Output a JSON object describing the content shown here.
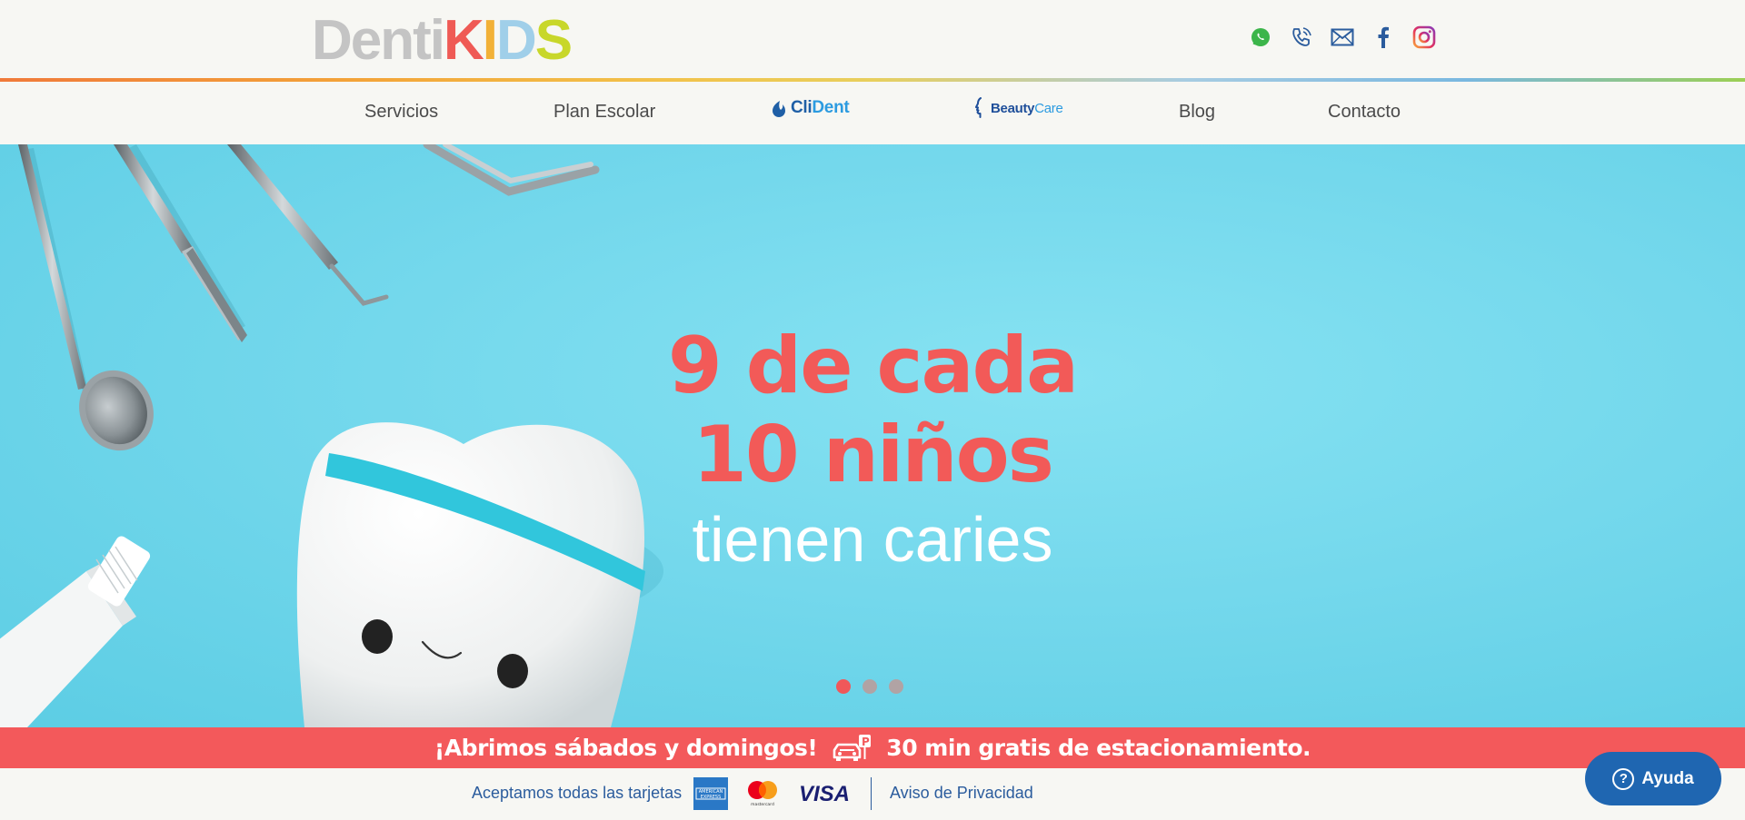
{
  "brand": {
    "logo_part1": "Denti",
    "logo_k": "K",
    "logo_i": "I",
    "logo_d": "D",
    "logo_s": "S"
  },
  "social_icons": [
    "whatsapp-icon",
    "phone-icon",
    "mail-icon",
    "facebook-icon",
    "instagram-icon"
  ],
  "nav": {
    "items": [
      {
        "label": "Servicios"
      },
      {
        "label": "Plan Escolar"
      },
      {
        "label": "Blog"
      },
      {
        "label": "Contacto"
      }
    ],
    "clident": {
      "part1": "Cli",
      "part2": "Dent"
    },
    "beautycare": {
      "part1": "Beauty",
      "part2": "Care"
    }
  },
  "hero": {
    "headline_line1": "9 de cada",
    "headline_line2": "10 niños",
    "subline": "tienen caries",
    "slides": 3,
    "active_slide": 1
  },
  "promo": {
    "weekend": "¡Abrimos sábados y domingos!",
    "parking": "30 min gratis de estacionamiento."
  },
  "footer": {
    "accept": "Aceptamos todas las tarjetas",
    "cards": [
      "American Express",
      "Mastercard",
      "VISA"
    ],
    "privacy": "Aviso de Privacidad"
  },
  "help": {
    "label": "Ayuda"
  },
  "colors": {
    "accent_red": "#f3595b",
    "hero_bg": "#74d8ec",
    "link_blue": "#2b5c9d",
    "help_blue": "#1f66b1"
  }
}
